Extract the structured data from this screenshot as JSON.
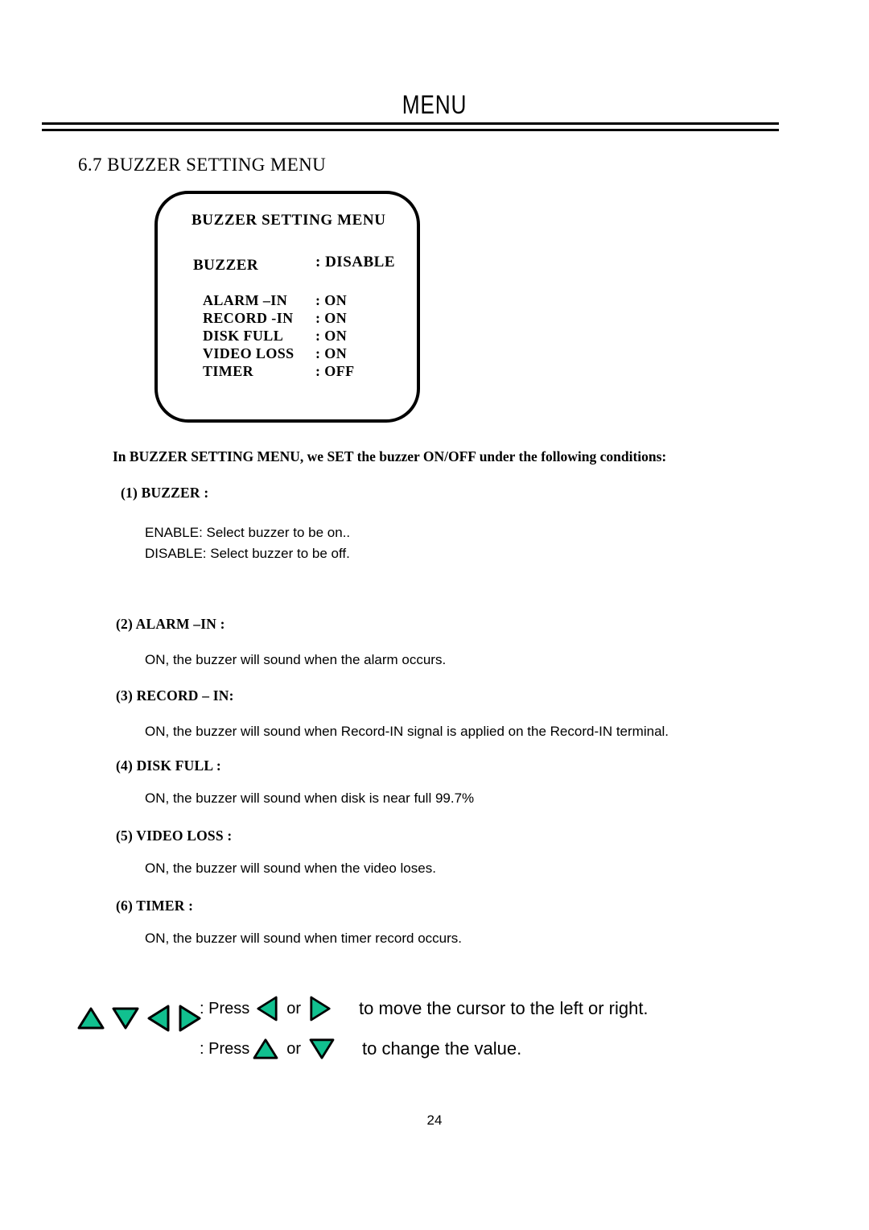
{
  "header": {
    "title": "MENU"
  },
  "section": {
    "number": "6.7",
    "heading": "6.7 BUZZER SETTING MENU"
  },
  "osd_menu": {
    "title": "BUZZER  SETTING  MENU",
    "primary": {
      "label": "BUZZER",
      "value": ": DISABLE"
    },
    "rows": [
      {
        "label": "ALARM –IN",
        "value": ": ON"
      },
      {
        "label": "RECORD -IN",
        "value": ": ON"
      },
      {
        "label": "DISK FULL",
        "value": ": ON"
      },
      {
        "label": "VIDEO LOSS",
        "value": ": ON"
      },
      {
        "label": "TIMER",
        "value": ": OFF"
      }
    ]
  },
  "body": {
    "intro": "In BUZZER  SETTING  MENU, we SET the buzzer ON/OFF under the following conditions:",
    "items": [
      {
        "heading": "(1)  BUZZER :",
        "lines": [
          "ENABLE: Select buzzer to be on..",
          "DISABLE: Select buzzer to be off."
        ]
      },
      {
        "heading": "(2) ALARM –IN :",
        "lines": [
          "ON, the buzzer will sound when the alarm occurs."
        ]
      },
      {
        "heading": "(3)  RECORD – IN:",
        "lines": [
          "ON, the buzzer will sound when Record-IN signal is applied on the Record-IN  terminal."
        ]
      },
      {
        "heading": "(4) DISK FULL :",
        "lines": [
          "ON, the buzzer will sound when disk is near full 99.7%"
        ]
      },
      {
        "heading": "(5) VIDEO LOSS :",
        "lines": [
          "ON, the buzzer will sound when the video loses."
        ]
      },
      {
        "heading": "(6) TIMER :",
        "lines": [
          "ON, the buzzer will sound when timer record occurs."
        ]
      }
    ]
  },
  "legend": {
    "keys": [
      "up",
      "down",
      "left",
      "right"
    ],
    "lines": [
      {
        "press": ": Press",
        "first_key": "left",
        "or": "or",
        "second_key": "right",
        "tail": "to move the cursor to the left or right."
      },
      {
        "press": ": Press",
        "first_key": "up",
        "or": "or",
        "second_key": "down",
        "tail": "to change the value."
      }
    ]
  },
  "footer": {
    "page_number": "24"
  },
  "colors": {
    "arrow_fill": "#11C08F",
    "arrow_stroke": "#000000",
    "text": "#000000",
    "background": "#ffffff"
  }
}
